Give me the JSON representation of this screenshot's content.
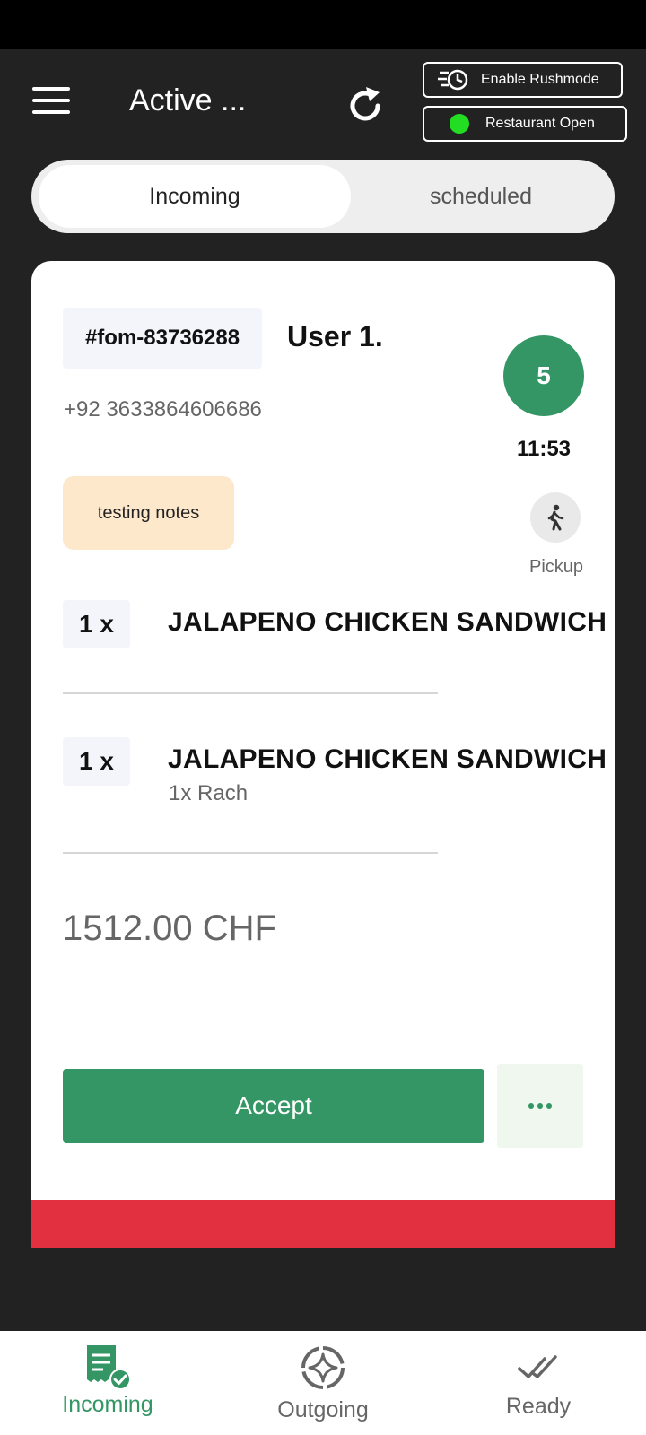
{
  "header": {
    "title": "Active ...",
    "rush_label": "Enable Rushmode",
    "restaurant_label": "Restaurant Open"
  },
  "tabs": [
    {
      "label": "Incoming",
      "active": true
    },
    {
      "label": "scheduled",
      "active": false
    }
  ],
  "order": {
    "id": "#fom-83736288",
    "customer": "User 1.",
    "phone": "+92 3633864606686",
    "count": "5",
    "time": "11:53",
    "notes": "testing notes",
    "type": "Pickup",
    "items": [
      {
        "qty": "1 x",
        "name": "JALAPENO CHICKEN SANDWICH",
        "sub": ""
      },
      {
        "qty": "1 x",
        "name": "JALAPENO CHICKEN SANDWICH",
        "sub": "1x Rach"
      }
    ],
    "total": "1512.00 CHF",
    "accept_label": "Accept"
  },
  "nav": {
    "incoming": "Incoming",
    "outgoing": "Outgoing",
    "ready": "Ready"
  },
  "colors": {
    "accent_green": "#339664",
    "status_open": "#22dd22",
    "alert_red": "#e33040",
    "notes_bg": "#fde8cc"
  }
}
